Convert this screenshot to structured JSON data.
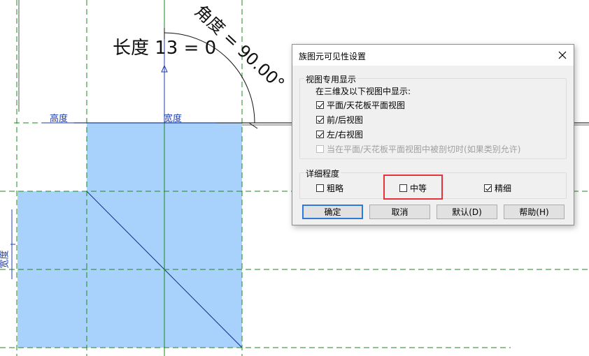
{
  "drawing": {
    "dimension_labels": {
      "height": "高度",
      "width_top": "宽度",
      "width_left": "宽度"
    },
    "length_text": "长度 13 = 0",
    "angle_text": "角度 = 90.00°",
    "colors": {
      "fill": "#a8d2fb",
      "ref_plane": "#1b8a1b",
      "dimension": "#1f3fae"
    }
  },
  "dialog": {
    "title": "族图元可见性设置",
    "view_group": {
      "title": "视图专用显示",
      "subtitle": "在三维及以下视图中显示:",
      "options": [
        {
          "label": "平面/天花板平面视图",
          "checked": true,
          "enabled": true
        },
        {
          "label": "前/后视图",
          "checked": true,
          "enabled": true
        },
        {
          "label": "左/右视图",
          "checked": true,
          "enabled": true
        },
        {
          "label": "当在平面/天花板平面视图中被剖切时(如果类别允许)",
          "checked": false,
          "enabled": false
        }
      ]
    },
    "detail_group": {
      "title": "详细程度",
      "coarse": {
        "label": "粗略",
        "checked": false
      },
      "medium": {
        "label": "中等",
        "checked": false
      },
      "fine": {
        "label": "精细",
        "checked": true
      }
    },
    "buttons": {
      "ok": "确定",
      "cancel": "取消",
      "default": "默认(D)",
      "help": "帮助(H)"
    },
    "highlight_color": "#e5333b"
  }
}
